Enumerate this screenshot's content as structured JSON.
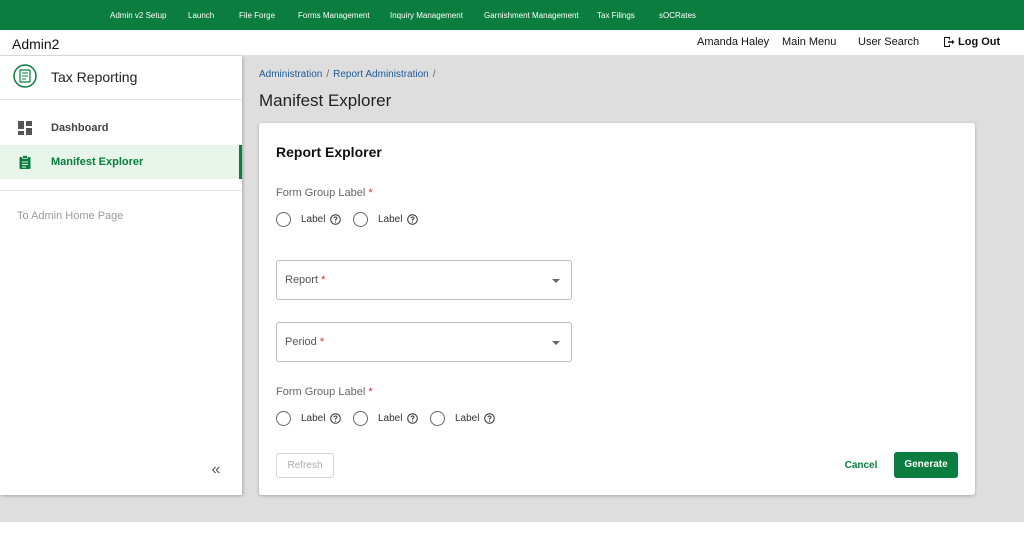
{
  "topnav": {
    "items": [
      "Admin v2 Setup",
      "Launch",
      "File Forge",
      "Forms Management",
      "Inquiry Management",
      "Garnishment Management",
      "Tax Filings",
      "sOCRates"
    ]
  },
  "header": {
    "brand": "Admin2",
    "user_name": "Amanda Haley",
    "main_menu": "Main Menu",
    "user_search": "User Search",
    "logout": "Log Out"
  },
  "sidebar": {
    "app_title": "Tax Reporting",
    "items": [
      {
        "label": "Dashboard",
        "icon": "dashboard-icon",
        "active": false
      },
      {
        "label": "Manifest Explorer",
        "icon": "clipboard-icon",
        "active": true
      }
    ],
    "home_link": "To Admin Home Page",
    "collapse": "«"
  },
  "breadcrumb": [
    "Administration",
    "Report Administration"
  ],
  "page_title": "Manifest Explorer",
  "card": {
    "title": "Report Explorer",
    "group1": {
      "label": "Form Group Label",
      "required": "*",
      "options": [
        "Label",
        "Label"
      ]
    },
    "report_select": {
      "label": "Report",
      "required": "*"
    },
    "period_select": {
      "label": "Period",
      "required": "*"
    },
    "group2": {
      "label": "Form Group Label",
      "required": "*",
      "options": [
        "Label",
        "Label",
        "Label"
      ]
    },
    "refresh": "Refresh",
    "cancel": "Cancel",
    "generate": "Generate"
  },
  "colors": {
    "brand_green": "#0b7d3e",
    "link_blue": "#1f5a96",
    "required_red": "#d32f2f"
  }
}
